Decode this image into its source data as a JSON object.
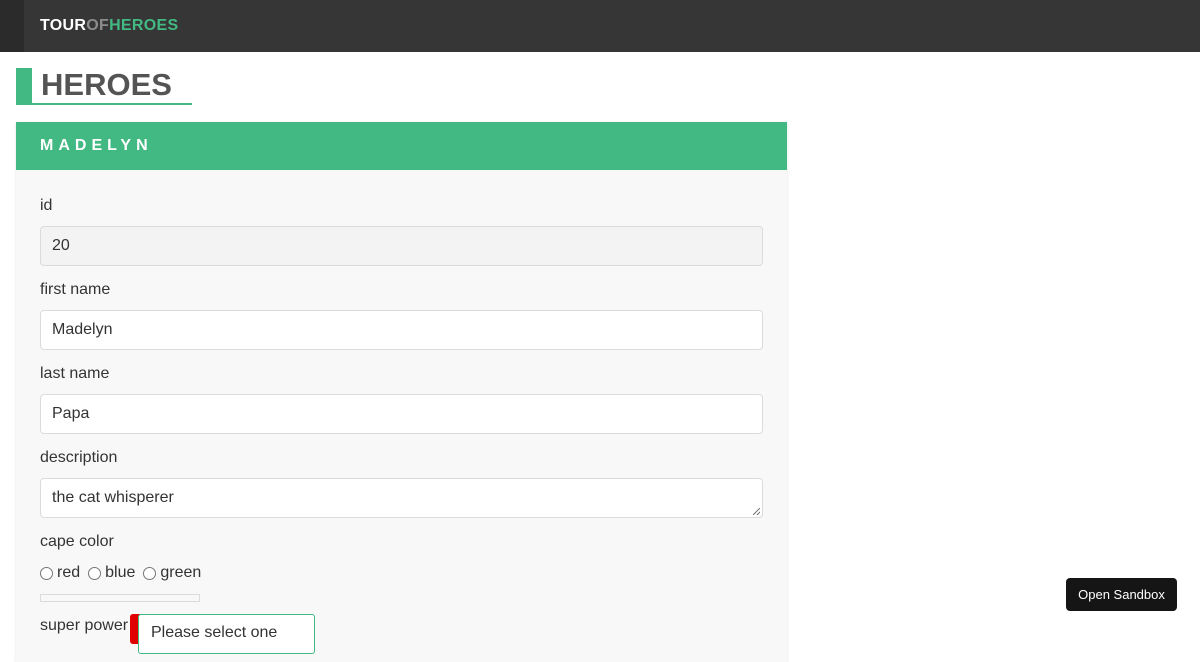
{
  "header": {
    "brand_part1": "TOUR",
    "brand_part2": "OF",
    "brand_part3": "HEROES"
  },
  "page": {
    "title": "HEROES"
  },
  "hero_card": {
    "title": "MADELYN",
    "fields": {
      "id": {
        "label": "id",
        "value": "20"
      },
      "first_name": {
        "label": "first name",
        "value": "Madelyn"
      },
      "last_name": {
        "label": "last name",
        "value": "Papa"
      },
      "description": {
        "label": "description",
        "value": "the cat whisperer"
      }
    },
    "cape_color": {
      "label": "cape color",
      "options": [
        "red",
        "blue",
        "green"
      ]
    },
    "super_power": {
      "label": "super power",
      "select_text": "Please select one"
    }
  },
  "sandbox": {
    "label": "Open Sandbox"
  },
  "colors": {
    "accent": "#42b983",
    "nav_bg": "#363636",
    "required": "#e00000"
  }
}
